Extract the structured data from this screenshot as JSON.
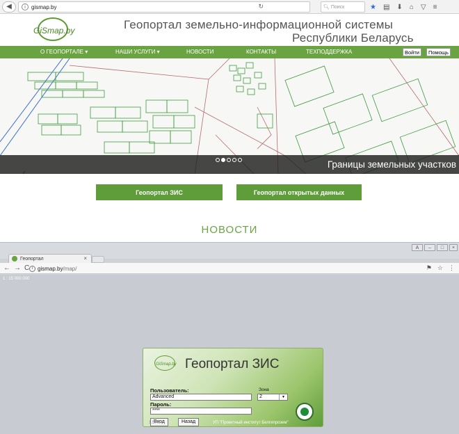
{
  "top_browser": {
    "url": "gismap.by",
    "search_placeholder": "Поиск"
  },
  "site": {
    "logo_text": "GiSmap.by",
    "title_line1": "Геопортал земельно-информационной системы",
    "title_line2": "Республики Беларусь",
    "nav": [
      {
        "label": "О ГЕОПОРТАЛЕ ▾"
      },
      {
        "label": "НАШИ УСЛУГИ ▾"
      },
      {
        "label": "НОВОСТИ"
      },
      {
        "label": "КОНТАКТЫ"
      },
      {
        "label": "ТЕХПОДДЕРЖКА"
      }
    ],
    "login_button": "Войти",
    "help_button": "Помощь",
    "banner_caption": "Границы земельных участков",
    "button_zis": "Геопортал ЗИС",
    "button_open_data": "Геопортал открытых данных",
    "news_heading": "НОВОСТИ"
  },
  "bottom_browser": {
    "tab_title": "Геопортал",
    "url_host": "gismap.by",
    "url_path": "/map/",
    "scale_text": "1 : 15 000 000"
  },
  "login_form": {
    "title": "Геопортал ЗИС",
    "logo_text": "GiSmap.by",
    "user_label": "Пользователь:",
    "user_value": "Advanced",
    "zone_label": "Зона",
    "zone_value": "2",
    "password_label": "Пароль:",
    "password_value": "****",
    "enter_button": "Вход",
    "back_button": "Назад",
    "version": "1.5.40",
    "institute": "УП \"Проектный институт Белгипрозем\""
  },
  "colors": {
    "accent_green": "#6aa342",
    "button_green": "#5f9d3a"
  }
}
